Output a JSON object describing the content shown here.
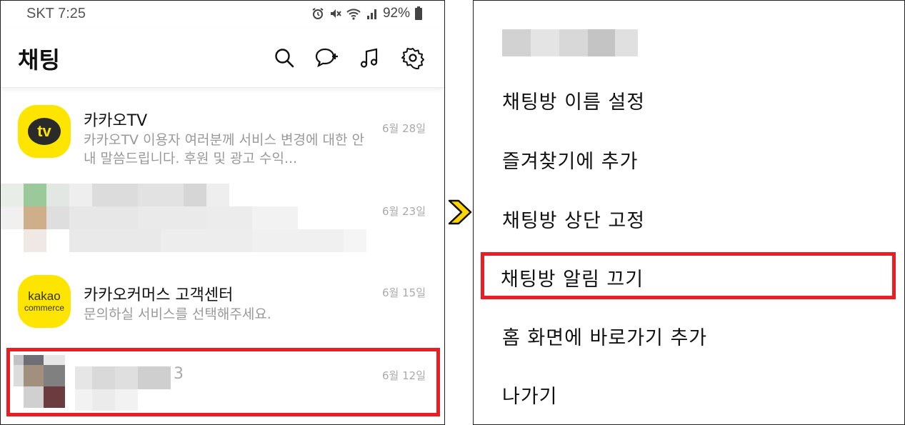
{
  "status_bar": {
    "carrier_time": "SKT 7:25",
    "battery": "92%",
    "icons": [
      "alarm-icon",
      "mute-icon",
      "wifi-icon",
      "signal-icon",
      "battery-icon"
    ]
  },
  "header": {
    "title": "채팅",
    "icons": [
      "search-icon",
      "new-chat-icon",
      "music-icon",
      "settings-icon"
    ]
  },
  "chats": [
    {
      "name": "카카오TV",
      "preview": "카카오TV 이용자 여러분께 서비스 변경에 대한 안내 말씀드립니다. 후원 및 광고 수익...",
      "date": "6월 28일",
      "avatar_text": "tv"
    },
    {
      "name": "",
      "preview": "",
      "date": "6월 23일"
    },
    {
      "name": "카카오커머스 고객센터",
      "preview": "문의하실 서비스를 선택해주세요.",
      "date": "6월 15일",
      "avatar_line1": "kakao",
      "avatar_line2": "commerce"
    },
    {
      "name": "",
      "member_count": "3",
      "date": "6월 12일"
    }
  ],
  "context_menu": {
    "items": [
      "채팅방 이름 설정",
      "즐겨찾기에 추가",
      "채팅방 상단 고정",
      "채팅방 알림 끄기",
      "홈 화면에 바로가기 추가",
      "나가기"
    ],
    "highlighted_item": "채팅방 알림 끄기"
  },
  "colors": {
    "kakao_yellow": "#FEE500",
    "highlight_red": "#E81E25",
    "arrow_yellow": "#FFD400"
  }
}
